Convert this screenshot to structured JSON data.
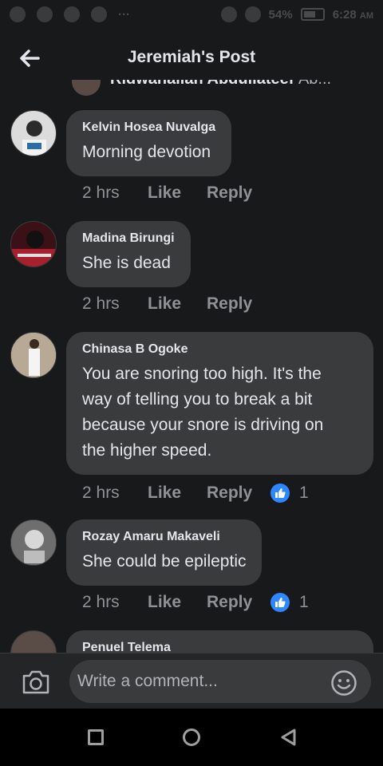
{
  "status_bar": {
    "battery": "54%",
    "time": "6:28",
    "ampm": "AM"
  },
  "header": {
    "title": "Jeremiah's Post",
    "back_icon": "arrow-left-icon"
  },
  "cut_off_above": {
    "author": "Ridwanallah Abdullateef",
    "trailing": "Ab..."
  },
  "comments": [
    {
      "author": "Kelvin Hosea Nuvalga",
      "text": "Morning devotion",
      "time": "2 hrs",
      "like_label": "Like",
      "reply_label": "Reply",
      "reactions": null,
      "avatar_color": "#dcdcdc"
    },
    {
      "author": "Madina Birungi",
      "text": "She is dead",
      "time": "2 hrs",
      "like_label": "Like",
      "reply_label": "Reply",
      "reactions": null,
      "avatar_color": "#8a1c2a"
    },
    {
      "author": "Chinasa B Ogoke",
      "text_lines": [
        "You are snoring too high. It's the",
        "way of telling you to break a bit",
        "because your snore is driving on",
        "the higher speed."
      ],
      "time": "2 hrs",
      "like_label": "Like",
      "reply_label": "Reply",
      "reactions": "1",
      "avatar_color": "#9a8a76"
    },
    {
      "author": "Rozay Amaru Makaveli",
      "text": "She could be epileptic",
      "time": "2 hrs",
      "like_label": "Like",
      "reply_label": "Reply",
      "reactions": "1",
      "avatar_color": "#7c7c7c"
    },
    {
      "author": "Penuel Telema",
      "partial": true,
      "avatar_color": "#5a4c46"
    }
  ],
  "composer": {
    "placeholder": "Write a comment...",
    "camera_icon": "camera-icon",
    "emoji_icon": "emoji-icon"
  },
  "nav": {
    "square_icon": "recent-apps-icon",
    "circle_icon": "home-icon",
    "triangle_icon": "back-triangle-icon"
  },
  "colors": {
    "background": "#18191a",
    "bubble": "#3a3b3c",
    "meta_text": "#8f9195",
    "like_blue": "#2d88ff"
  }
}
